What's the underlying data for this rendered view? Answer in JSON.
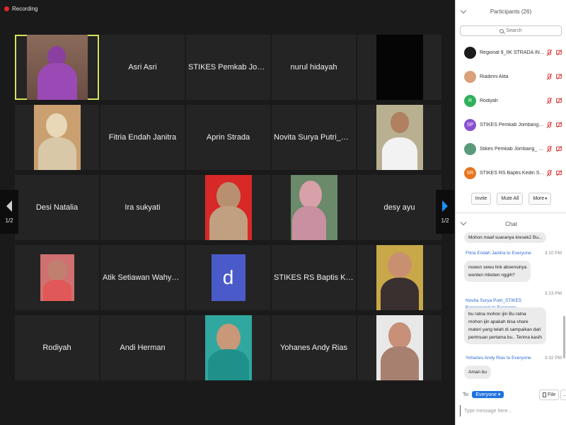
{
  "recording_label": "Recording",
  "pager": {
    "page": "1/2"
  },
  "tiles": [
    {
      "name": "",
      "type": "photo"
    },
    {
      "name": "Asri Asri",
      "type": "name"
    },
    {
      "name": "STIKES Pemkab Jomba...",
      "type": "name"
    },
    {
      "name": "nurul hidayah",
      "type": "name"
    },
    {
      "name": "",
      "type": "black"
    },
    {
      "name": "",
      "type": "photo"
    },
    {
      "name": "Fitria Endah Janitra",
      "type": "name"
    },
    {
      "name": "Aprin Strada",
      "type": "name"
    },
    {
      "name": "Novita Surya Putri_STIK...",
      "type": "name"
    },
    {
      "name": "",
      "type": "photo"
    },
    {
      "name": "Desi Natalia",
      "type": "name"
    },
    {
      "name": "Ira sukyati",
      "type": "name"
    },
    {
      "name": "",
      "type": "photo"
    },
    {
      "name": "",
      "type": "photo"
    },
    {
      "name": "desy ayu",
      "type": "name"
    },
    {
      "name": "",
      "type": "photo"
    },
    {
      "name": "Atik Setiawan Wahyuni...",
      "type": "name"
    },
    {
      "name": "d",
      "type": "letter"
    },
    {
      "name": "STIKES RS Baptis Kedir...",
      "type": "name"
    },
    {
      "name": "",
      "type": "photo"
    },
    {
      "name": "Rodiyah",
      "type": "name"
    },
    {
      "name": "Andi Herman",
      "type": "name"
    },
    {
      "name": "",
      "type": "photo"
    },
    {
      "name": "Yohanes Andy Rias",
      "type": "name"
    },
    {
      "name": "",
      "type": "photo"
    }
  ],
  "participants": {
    "title": "Participants (26)",
    "search_placeholder": "Search",
    "list": [
      {
        "name": "Regional 9_IIK STRADA INDO...",
        "initials": "",
        "color": "#1c1c1c"
      },
      {
        "name": "Riadinni Alita",
        "initials": "",
        "color": "#d9a07a"
      },
      {
        "name": "Rodiyah",
        "initials": "R",
        "color": "#2fb05a"
      },
      {
        "name": "STIKES Pemkab Jombang -...",
        "initials": "SP",
        "color": "#8a4fcf"
      },
      {
        "name": "Stikes Pemkab Jombang_ Si...",
        "initials": "",
        "color": "#5a9a7a"
      },
      {
        "name": "STIKES RS Baptis Kediri Srin...",
        "initials": "SR",
        "color": "#e8741c"
      }
    ],
    "invite_label": "Invite",
    "mute_all_label": "Mute All",
    "more_label": "More"
  },
  "chat": {
    "title": "Chat",
    "messages": [
      {
        "from": "",
        "time": "",
        "text": "Mohon maaf suaranya kresek2 Bu..."
      },
      {
        "from": "Fitria Endah Janitra to Everyone",
        "time": "3:10 PM",
        "text": "nuwun sewu link absensinya\nwonten mboten nggih?"
      },
      {
        "from": "Novita Surya Putri_STIKES\nBanyuwangi to Everyone",
        "time": "3:23 PM",
        "text": "bu ratna mohon ijin Bu ratna\nmohon ijin apakah bisa share\nmateri yang telah di sampaikan dari\npertmuan pertama bu.. Terima kasih"
      },
      {
        "from": "Yohanes Andy Rias to Everyone",
        "time": "3:32 PM",
        "text": "Aman bu"
      }
    ],
    "to_label": "To:",
    "to_value": "Everyone",
    "file_label": "File",
    "more_label": "...",
    "input_placeholder": "Type message here..."
  }
}
